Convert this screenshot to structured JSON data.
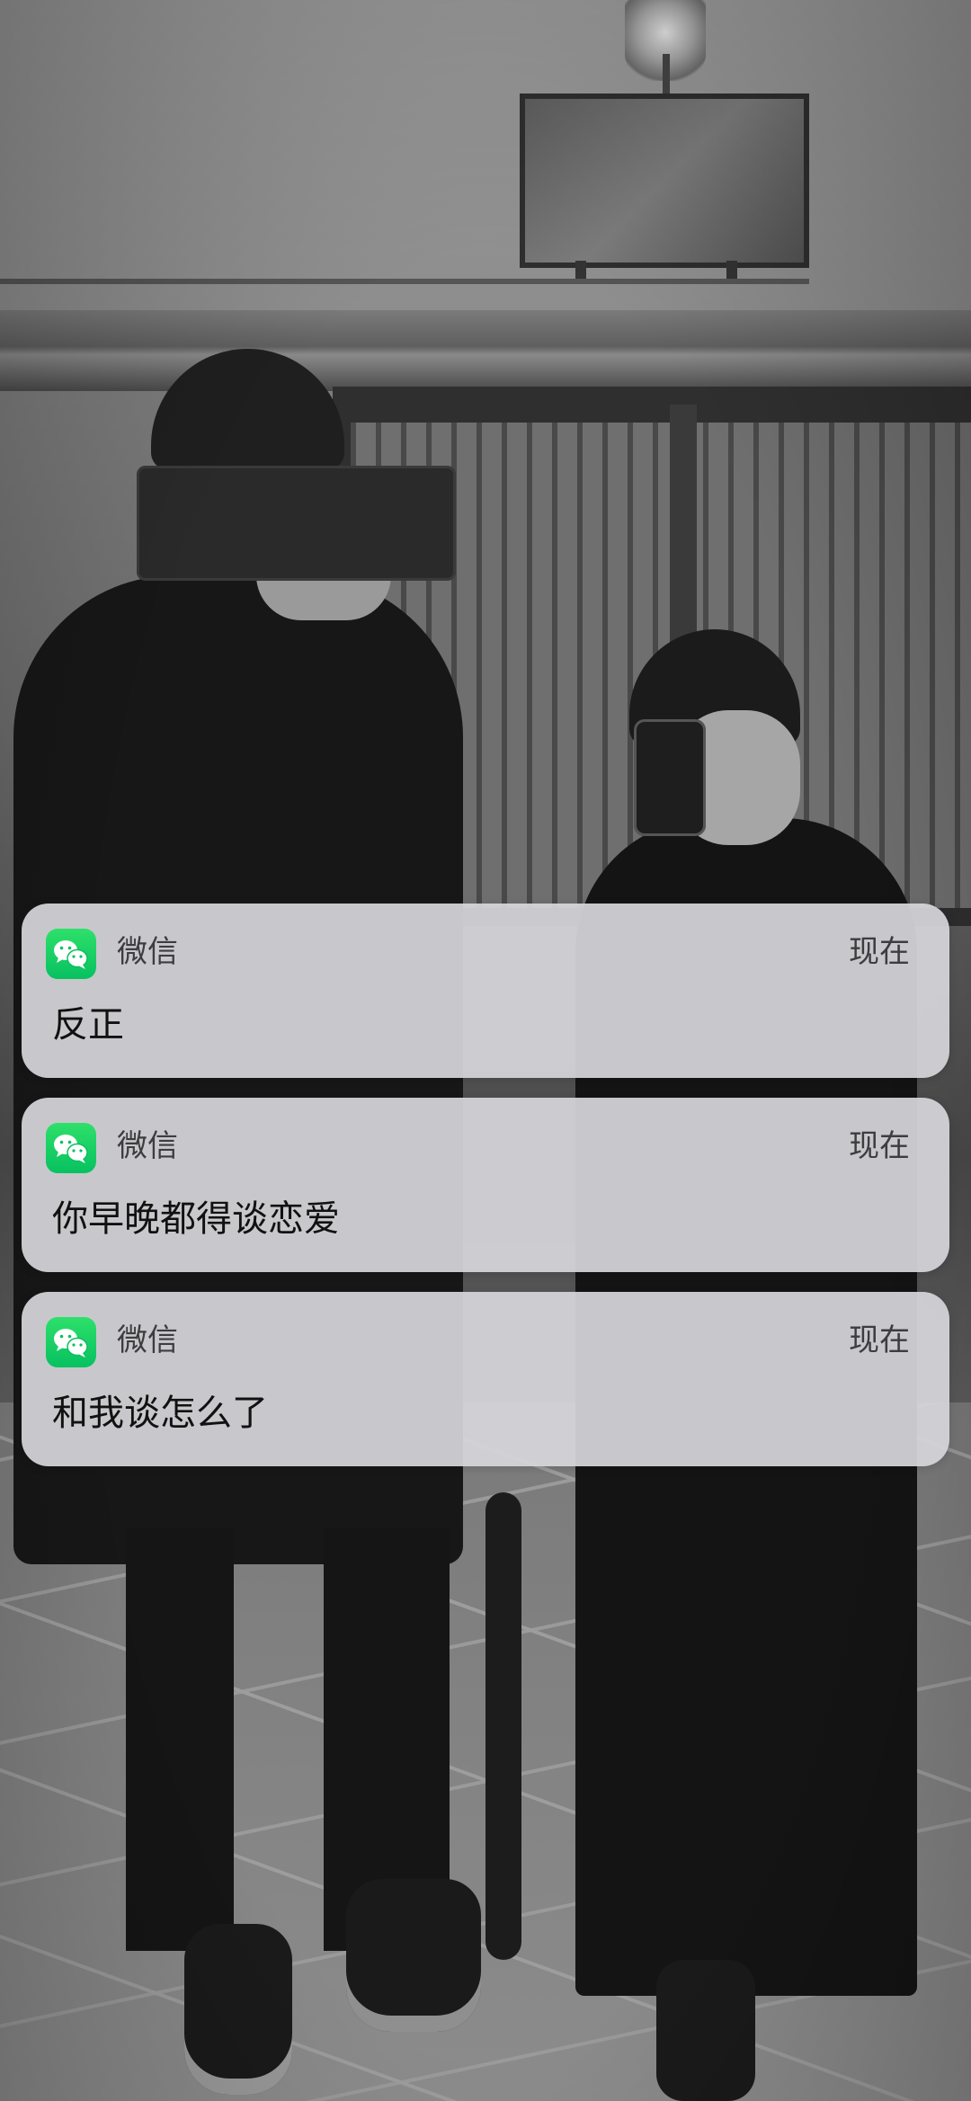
{
  "notifications": [
    {
      "icon": "wechat-icon",
      "app": "微信",
      "time": "现在",
      "message": "反正"
    },
    {
      "icon": "wechat-icon",
      "app": "微信",
      "time": "现在",
      "message": "你早晚都得谈恋爱"
    },
    {
      "icon": "wechat-icon",
      "app": "微信",
      "time": "现在",
      "message": "和我谈怎么了"
    }
  ],
  "colors": {
    "wechat_green": "#07c160",
    "card_background": "#d6d6da",
    "primary_text": "#111111",
    "secondary_text": "#3d3d40"
  }
}
